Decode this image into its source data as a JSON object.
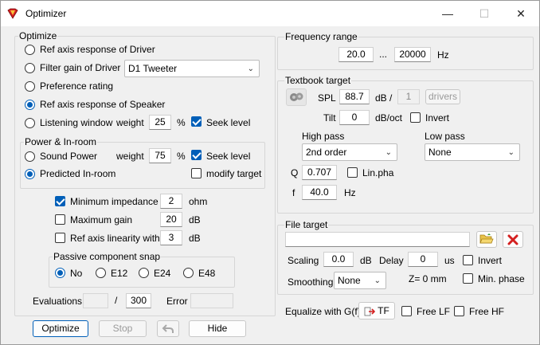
{
  "window": {
    "title": "Optimizer",
    "min_icon": "—",
    "max_icon": "☐",
    "close_icon": "✕"
  },
  "optimize": {
    "group_label": "Optimize",
    "ref_axis_driver": "Ref axis response of Driver",
    "filter_gain_driver": "Filter gain of Driver",
    "driver_select": "D1 Tweeter",
    "preference_rating": "Preference rating",
    "ref_axis_speaker": "Ref axis response of Speaker",
    "listening_window": "Listening window",
    "weight_label": "weight",
    "weight_value": "25",
    "percent": "%",
    "seek_level": "Seek level"
  },
  "power": {
    "group_label": "Power & In-room",
    "sound_power": "Sound Power",
    "weight_label": "weight",
    "weight_value": "75",
    "percent": "%",
    "seek_level": "Seek level",
    "predicted_inroom": "Predicted In-room",
    "modify_target": "modify target"
  },
  "limits": {
    "min_impedance": "Minimum impedance",
    "min_impedance_value": "2",
    "ohm": "ohm",
    "max_gain": "Maximum gain",
    "max_gain_value": "20",
    "db1": "dB",
    "ref_linearity": "Ref axis linearity within",
    "ref_linearity_value": "3",
    "db2": "dB"
  },
  "snap": {
    "group_label": "Passive component snap",
    "options": [
      "No",
      "E12",
      "E24",
      "E48"
    ]
  },
  "evaluations": {
    "label": "Evaluations",
    "current": "",
    "slash": "/",
    "max": "300",
    "error_label": "Error",
    "error_value": ""
  },
  "buttons": {
    "optimize": "Optimize",
    "stop": "Stop",
    "hide": "Hide"
  },
  "freq_range": {
    "group_label": "Frequency range",
    "min": "20.0",
    "dots": "...",
    "max": "20000",
    "unit": "Hz"
  },
  "textbook": {
    "group_label": "Textbook target",
    "spl_label": "SPL",
    "spl_value": "88.7",
    "db_slash": "dB /",
    "drivers_count": "1",
    "drivers_button": "drivers",
    "tilt_label": "Tilt",
    "tilt_value": "0",
    "tilt_unit": "dB/oct",
    "invert": "Invert",
    "high_pass_label": "High pass",
    "high_pass_value": "2nd order",
    "low_pass_label": "Low pass",
    "low_pass_value": "None",
    "q_label": "Q",
    "q_value": "0.707",
    "lin_pha": "Lin.pha",
    "f_label": "f",
    "f_value": "40.0",
    "f_unit": "Hz"
  },
  "file_target": {
    "group_label": "File target",
    "path": "",
    "scaling_label": "Scaling",
    "scaling_value": "0.0",
    "scaling_unit": "dB",
    "delay_label": "Delay",
    "delay_value": "0",
    "delay_unit": "us",
    "invert": "Invert",
    "smoothing_label": "Smoothing",
    "smoothing_value": "None",
    "z_label": "Z= 0 mm",
    "min_phase": "Min. phase"
  },
  "equalize": {
    "label": "Equalize with G(f)",
    "tf_button": "TF",
    "free_lf": "Free LF",
    "free_hf": "Free HF"
  }
}
